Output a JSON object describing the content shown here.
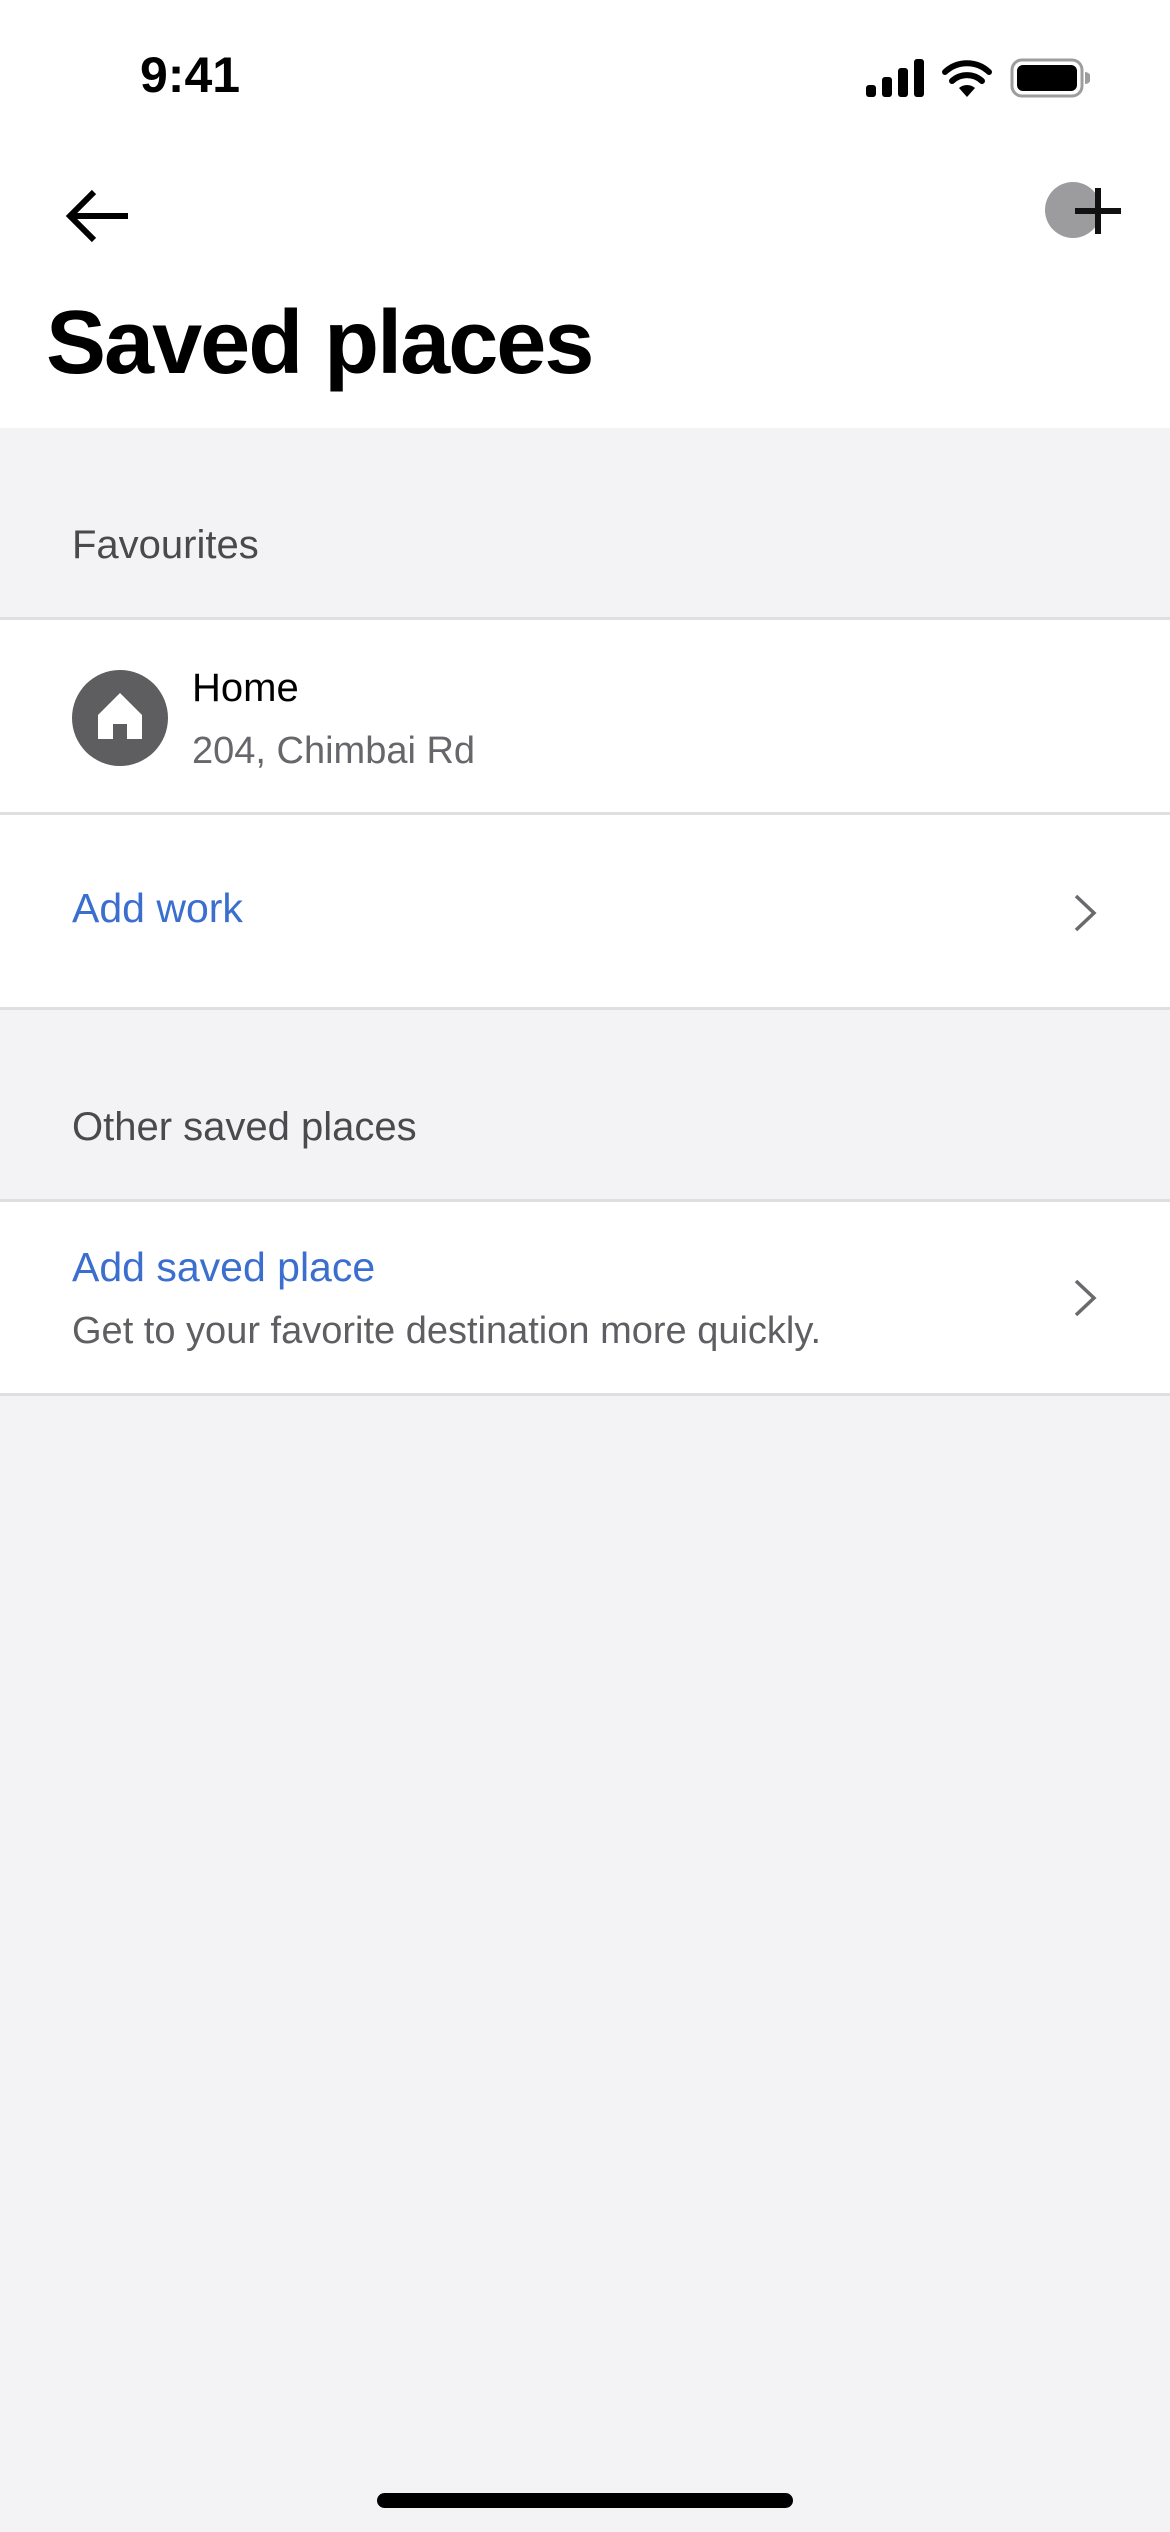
{
  "status_bar": {
    "time": "9:41",
    "icons": [
      "cellular-signal-icon",
      "wifi-icon",
      "battery-icon"
    ]
  },
  "nav": {
    "back_icon": "arrow-left-icon",
    "add_icon": "plus-icon"
  },
  "header": {
    "title": "Saved places"
  },
  "sections": [
    {
      "header": "Favourites",
      "items": [
        {
          "icon": "home-icon",
          "title": "Home",
          "subtitle": "204, Chimbai Rd"
        },
        {
          "title": "Add work",
          "chevron": "chevron-right-icon"
        }
      ]
    },
    {
      "header": "Other saved places",
      "items": [
        {
          "title": "Add saved place",
          "subtitle": "Get to your favorite destination more quickly.",
          "chevron": "chevron-right-icon"
        }
      ]
    }
  ],
  "colors": {
    "link": "#3a6ecf",
    "background": "#f3f2f5",
    "icon_circle": "#5e5d60"
  }
}
